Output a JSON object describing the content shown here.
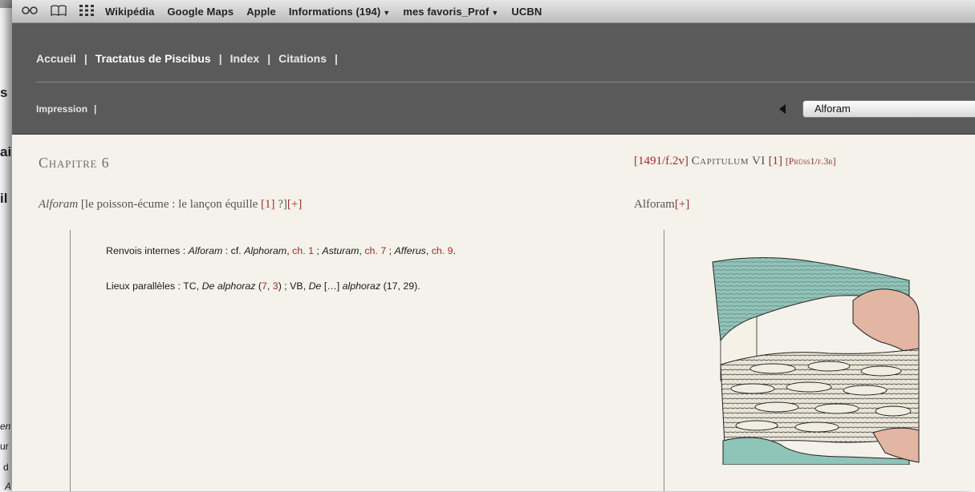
{
  "bookmarks_bar": {
    "items": [
      "Wikipédia",
      "Google Maps",
      "Apple",
      "Informations (194)",
      "mes favoris_Prof",
      "UCBN"
    ]
  },
  "site_nav": {
    "items": [
      {
        "label": "Accueil"
      },
      {
        "label": "Tractatus de Piscibus"
      },
      {
        "label": "Index"
      },
      {
        "label": "Citations"
      }
    ],
    "separator": "|",
    "print": "Impression",
    "selector_value": "Alforam"
  },
  "left": {
    "chapter": "Chapitre 6",
    "entry_name": "Alforam",
    "entry_gloss": "[le poisson-écume : le lançon équille",
    "entry_note": "[1]",
    "entry_tail": "?]",
    "plus": "[+]",
    "notes": {
      "renvois_label": "Renvois internes : ",
      "renvois_1": "Alforam",
      "renvois_2": " : cf. ",
      "renvois_3": "Alphoram",
      "renvois_ch1": "ch. 1",
      "renvois_4": " ; ",
      "renvois_5": "Asturam",
      "renvois_ch7": "ch. 7",
      "renvois_6": " ; ",
      "renvois_7": "Afferus",
      "renvois_ch9": "ch. 9",
      "renvois_end": ".",
      "lieux_label": "Lieux parallèles : TC, ",
      "lieux_1": "De alphoraz",
      "lieux_7": "7",
      "lieux_3": "3",
      "lieux_2": " ; VB, ",
      "lieux_de": "De",
      "lieux_ellipsis": " […] ",
      "lieux_4": "alphoraz",
      "lieux_5": " (17, 29)."
    }
  },
  "right": {
    "ref_1491": "[1491/f.2v]",
    "capitulum": "Capitulum VI",
    "note": "[1]",
    "ref_pruss": "[Prüss1/f.3r]",
    "entry_name": "Alforam",
    "plus": "[+]"
  },
  "background_window": {
    "frag1": "s",
    "frag2": "ai",
    "frag3": "il",
    "frag4": "en",
    "frag5": "ur",
    "frag6": "d",
    "frag7": "A"
  },
  "colors": {
    "nav_bg": "#5a5a5a",
    "link_red": "#9b2d2d",
    "page_bg": "#f4f2ea"
  }
}
